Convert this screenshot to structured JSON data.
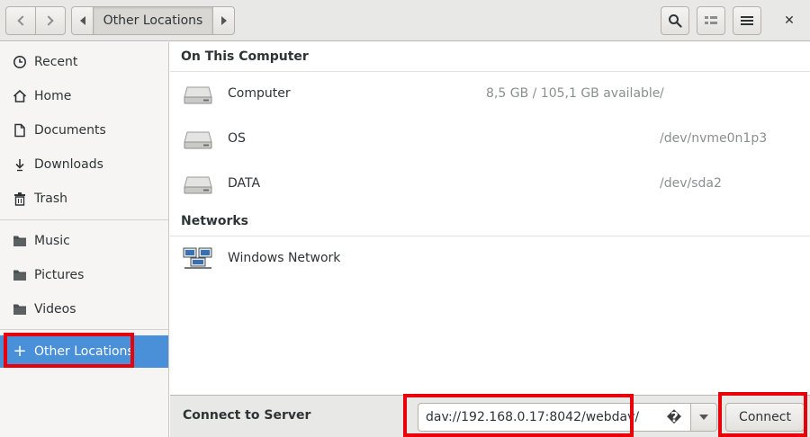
{
  "header": {
    "path_current": "Other Locations",
    "close_glyph": "✕"
  },
  "sidebar": {
    "items": [
      {
        "label": "Recent",
        "icon": "clock-icon"
      },
      {
        "label": "Home",
        "icon": "home-icon"
      },
      {
        "label": "Documents",
        "icon": "document-icon"
      },
      {
        "label": "Downloads",
        "icon": "download-icon"
      },
      {
        "label": "Trash",
        "icon": "trash-icon"
      },
      {
        "label": "Music",
        "icon": "folder-icon"
      },
      {
        "label": "Pictures",
        "icon": "folder-icon"
      },
      {
        "label": "Videos",
        "icon": "folder-icon"
      },
      {
        "label": "Other Locations",
        "icon": "plus-icon"
      }
    ],
    "active_color": "#4a90d9"
  },
  "main": {
    "section_computer": "On This Computer",
    "section_networks": "Networks",
    "devices": [
      {
        "name": "Computer",
        "space": "8,5 GB / 105,1 GB available",
        "path": "/"
      },
      {
        "name": "OS",
        "space": "",
        "path": "/dev/nvme0n1p3"
      },
      {
        "name": "DATA",
        "space": "",
        "path": "/dev/sda2"
      }
    ],
    "networks": [
      {
        "name": "Windows Network"
      }
    ]
  },
  "footer": {
    "label": "Connect to Server",
    "server_address": "dav://192.168.0.17:8042/webdav/",
    "help_glyph": "�",
    "connect_label": "Connect"
  },
  "highlight_color": "#e8000b"
}
